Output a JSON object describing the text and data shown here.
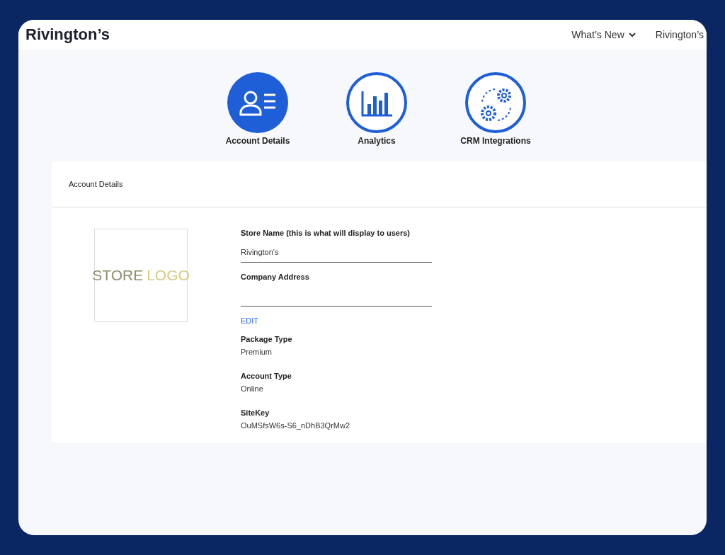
{
  "header": {
    "brand": "Rivington’s",
    "nav": [
      {
        "label": "What’s New",
        "dropdown": true
      },
      {
        "label": "Rivington’s",
        "dropdown": false
      }
    ]
  },
  "tabs": [
    {
      "label": "Account Details",
      "kind": "person",
      "selected": true
    },
    {
      "label": "Analytics",
      "kind": "chart",
      "selected": false
    },
    {
      "label": "CRM Integrations",
      "kind": "gears",
      "selected": false
    }
  ],
  "panel": {
    "title": "Account Details",
    "logo": {
      "word_1": "STORE",
      "word_2": "LOGO"
    },
    "fields": [
      {
        "kind": "input",
        "label": "Store Name (this is what will display to users)",
        "value": "Rivington's"
      },
      {
        "kind": "input",
        "label": "Company Address"
      },
      {
        "kind": "link",
        "label": "EDIT"
      },
      {
        "kind": "text",
        "label": "Package Type",
        "value": "Premium"
      },
      {
        "kind": "text",
        "label": "Account Type",
        "value": "Online"
      },
      {
        "kind": "text",
        "label": "SiteKey",
        "value": "OuMSfsW6s-S6_nDhB3QrMw2"
      }
    ]
  }
}
